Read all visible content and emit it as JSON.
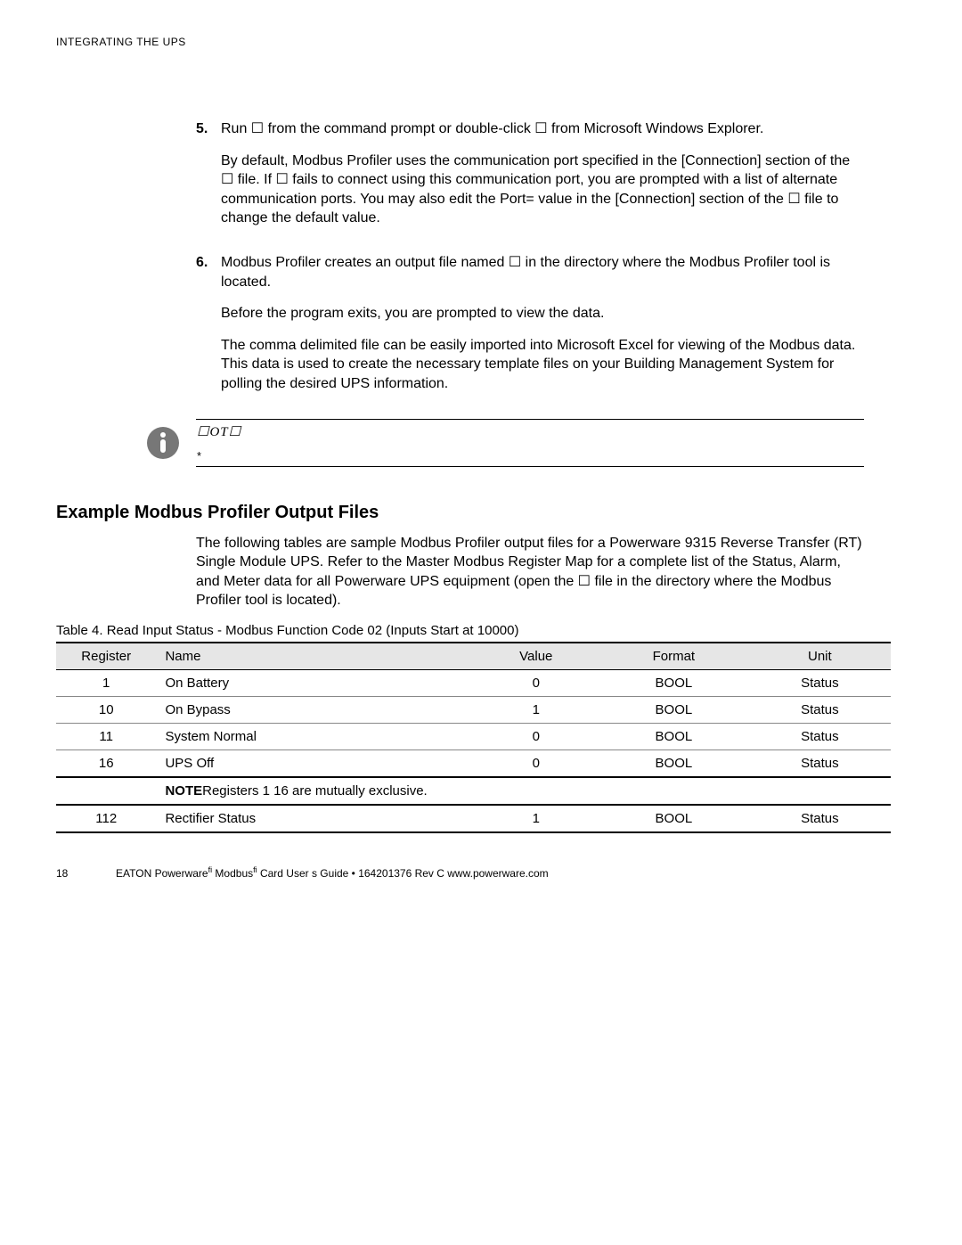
{
  "header": "INTEGRATING THE UPS",
  "steps": [
    {
      "num": "5.",
      "paras": [
        "Run  ☐          from the command prompt or double-click  ☐ from Microsoft Windows Explorer.",
        "By default, Modbus Profiler uses the communication port specified in the [Connection] section of the  ☐              file. If  ☐          fails to connect using this communication port, you are prompted with a list of alternate communication ports. You may also edit the  Port= value in the [Connection] section of the  ☐              file to change the default value."
      ]
    },
    {
      "num": "6.",
      "paras": [
        "Modbus Profiler creates an output file named  ☐                in the directory where the Modbus Profiler tool is located.",
        "Before the program exits, you are prompted to view the data.",
        "The comma delimited file can be easily imported into Microsoft Excel for viewing of the Modbus data. This data is used to create the necessary template files on your Building Management System for polling the desired UPS information."
      ]
    }
  ],
  "note": {
    "word": "☐OT☐",
    "ast": "*"
  },
  "section_title": "Example Modbus Profiler Output Files",
  "section_body": "The following tables are sample Modbus Profiler output files for a Powerware 9315 Reverse Transfer (RT) Single Module UPS. Refer to the Master Modbus Register Map for a complete list of the Status, Alarm, and Meter data for all Powerware UPS equipment (open the ☐                    file in the directory where the Modbus Profiler tool is located).",
  "table": {
    "caption": "Table 4. Read Input Status - Modbus Function Code 02 (Inputs Start at 10000)",
    "headers": [
      "Register",
      "Name",
      "Value",
      "Format",
      "Unit"
    ],
    "rows": [
      {
        "reg": "1",
        "name": "On Battery",
        "value": "0",
        "format": "BOOL",
        "unit": "Status"
      },
      {
        "reg": "10",
        "name": "On Bypass",
        "value": "1",
        "format": "BOOL",
        "unit": "Status"
      },
      {
        "reg": "11",
        "name": "System Normal",
        "value": "0",
        "format": "BOOL",
        "unit": "Status"
      },
      {
        "reg": "16",
        "name": "UPS Off",
        "value": "0",
        "format": "BOOL",
        "unit": "Status"
      }
    ],
    "note_label": "NOTE",
    "note_text": "Registers 1 16 are mutually exclusive.",
    "last_row": {
      "reg": "112",
      "name": "Rectifier Status",
      "value": "1",
      "format": "BOOL",
      "unit": "Status"
    }
  },
  "footer": {
    "page": "18",
    "text_a": "EATON  Powerware",
    "text_b": "  Modbus",
    "text_c": "  Card User s Guide   •   164201376 Rev C www.powerware.com",
    "tm": "fi"
  }
}
